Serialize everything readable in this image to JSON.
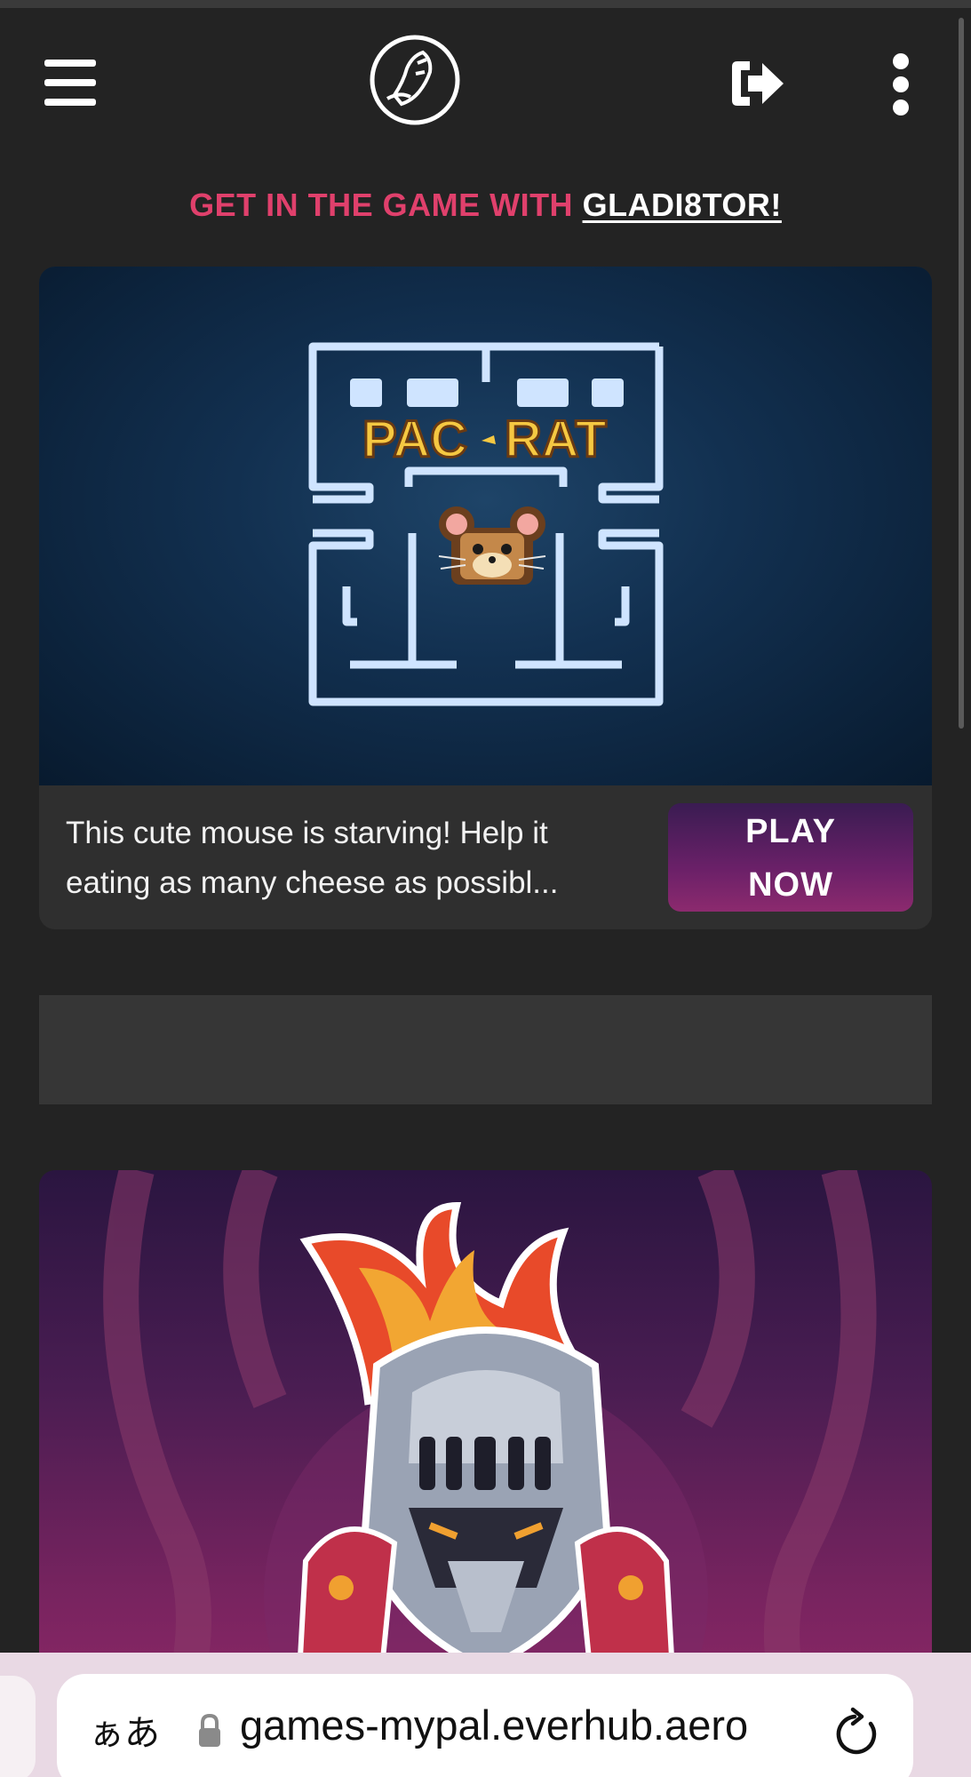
{
  "header": {
    "menu_icon": "hamburger-icon",
    "logo_icon": "gladiator-helmet-logo",
    "logout_icon": "logout-arrow-icon",
    "more_icon": "kebab-menu-icon"
  },
  "tagline": {
    "prefix": "GET IN THE GAME WITH ",
    "brand": "GLADI8TOR!",
    "prefix_color": "#e0406c"
  },
  "featured_game": {
    "logo_text_1": "PAC",
    "logo_text_2": "RAT",
    "description": "This cute mouse is starving! Help it eating as many cheese as possibl...",
    "play_label_1": "PLAY",
    "play_label_2": "NOW"
  },
  "browser": {
    "aa_label": "ぁあ",
    "url": "games-mypal.everhub.aero",
    "lock_icon": "lock-icon",
    "reload_icon": "reload-icon"
  }
}
